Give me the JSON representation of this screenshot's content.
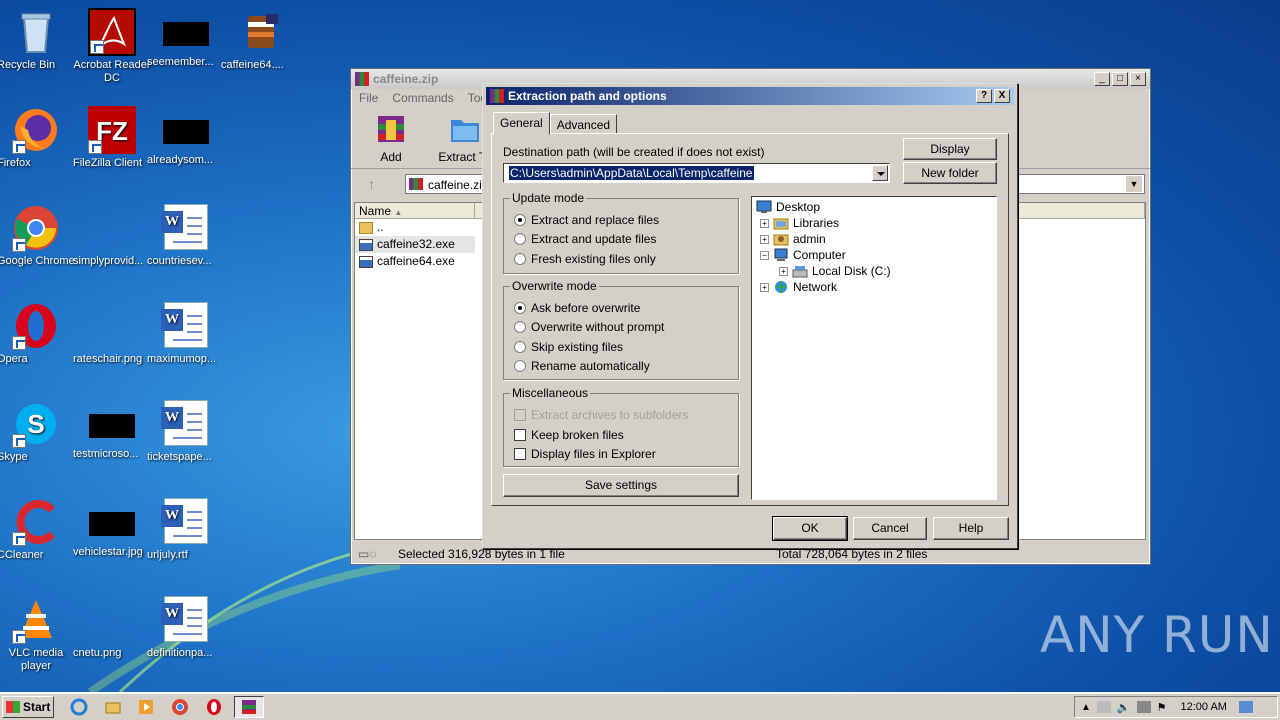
{
  "desktop": {
    "icons": [
      {
        "label": "Recycle Bin"
      },
      {
        "label": "Acrobat Reader DC"
      },
      {
        "label": "seemember..."
      },
      {
        "label": "caffeine64...."
      },
      {
        "label": "Firefox"
      },
      {
        "label": "FileZilla Client"
      },
      {
        "label": "alreadysom..."
      },
      {
        "label": "Google Chrome"
      },
      {
        "label": "simplyprovid..."
      },
      {
        "label": "countriesev..."
      },
      {
        "label": "Opera"
      },
      {
        "label": "rateschair.png"
      },
      {
        "label": "maximumop..."
      },
      {
        "label": "Skype"
      },
      {
        "label": "testmicroso..."
      },
      {
        "label": "ticketspape..."
      },
      {
        "label": "CCleaner"
      },
      {
        "label": "vehiclestar.jpg"
      },
      {
        "label": "urljuly.rtf"
      },
      {
        "label": "VLC media player"
      },
      {
        "label": "cnetu.png"
      },
      {
        "label": "definitionpa..."
      }
    ],
    "watermark": "ANY RUN"
  },
  "winrar": {
    "title": "caffeine.zip",
    "menu": [
      "File",
      "Commands",
      "Tools"
    ],
    "toolbar": {
      "add": "Add",
      "extract_to": "Extract To"
    },
    "address": "caffeine.zip",
    "columns": {
      "name": "Name"
    },
    "files": [
      {
        "name": ".."
      },
      {
        "name": "caffeine32.exe"
      },
      {
        "name": "caffeine64.exe"
      }
    ],
    "status_left": "Selected 316,928 bytes in 1 file",
    "status_right": "Total 728,064 bytes in 2 files"
  },
  "dialog": {
    "title": "Extraction path and options",
    "help_btn": "?",
    "close_btn": "X",
    "tabs": [
      "General",
      "Advanced"
    ],
    "dest_label": "Destination path (will be created if does not exist)",
    "dest_value": "C:\\Users\\admin\\AppData\\Local\\Temp\\caffeine",
    "display_btn": "Display",
    "new_folder_btn": "New folder",
    "update_mode": {
      "title": "Update mode",
      "options": [
        "Extract and replace files",
        "Extract and update files",
        "Fresh existing files only"
      ]
    },
    "overwrite_mode": {
      "title": "Overwrite mode",
      "options": [
        "Ask before overwrite",
        "Overwrite without prompt",
        "Skip existing files",
        "Rename automatically"
      ]
    },
    "misc": {
      "title": "Miscellaneous",
      "options": [
        "Extract archives to subfolders",
        "Keep broken files",
        "Display files in Explorer"
      ]
    },
    "save_settings": "Save settings",
    "tree": [
      "Desktop",
      "Libraries",
      "admin",
      "Computer",
      "Local Disk (C:)",
      "Network"
    ],
    "ok": "OK",
    "cancel": "Cancel",
    "help": "Help"
  },
  "taskbar": {
    "start": "Start",
    "clock": "12:00 AM"
  }
}
